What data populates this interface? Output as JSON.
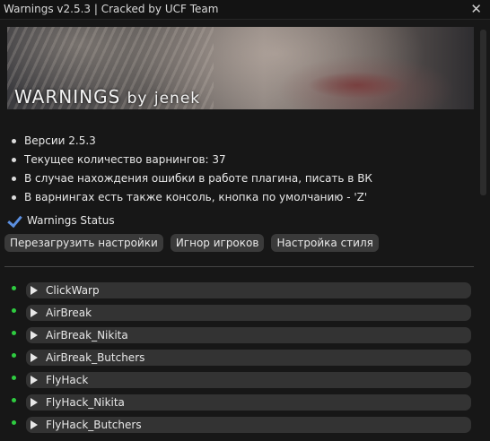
{
  "window": {
    "title": "Warnings v2.5.3 | Cracked by UCF Team",
    "close_glyph": "✕"
  },
  "banner": {
    "title": "WARNINGS",
    "by": "by",
    "author": "jenek"
  },
  "info_items": [
    "Версии 2.5.3",
    "Текущее количество варнингов: 37",
    "В случае нахождения ошибки в работе плагина, писать в ВК",
    "В варнингах есть также консоль, кнопка по умолчанию - 'Z'"
  ],
  "status": {
    "label": "Warnings Status",
    "checked": true
  },
  "buttons": {
    "reload": "Перезагрузить настройки",
    "ignore": "Игнор игроков",
    "style": "Настройка стиля"
  },
  "warnings": [
    {
      "name": "ClickWarp",
      "active": true
    },
    {
      "name": "AirBreak",
      "active": true
    },
    {
      "name": "AirBreak_Nikita",
      "active": true
    },
    {
      "name": "AirBreak_Butchers",
      "active": true
    },
    {
      "name": "FlyHack",
      "active": true
    },
    {
      "name": "FlyHack_Nikita",
      "active": true
    },
    {
      "name": "FlyHack_Butchers",
      "active": true
    }
  ],
  "colors": {
    "accent": "#5b8fe0",
    "active_dot": "#2ecc40",
    "row_bg": "#333333"
  }
}
